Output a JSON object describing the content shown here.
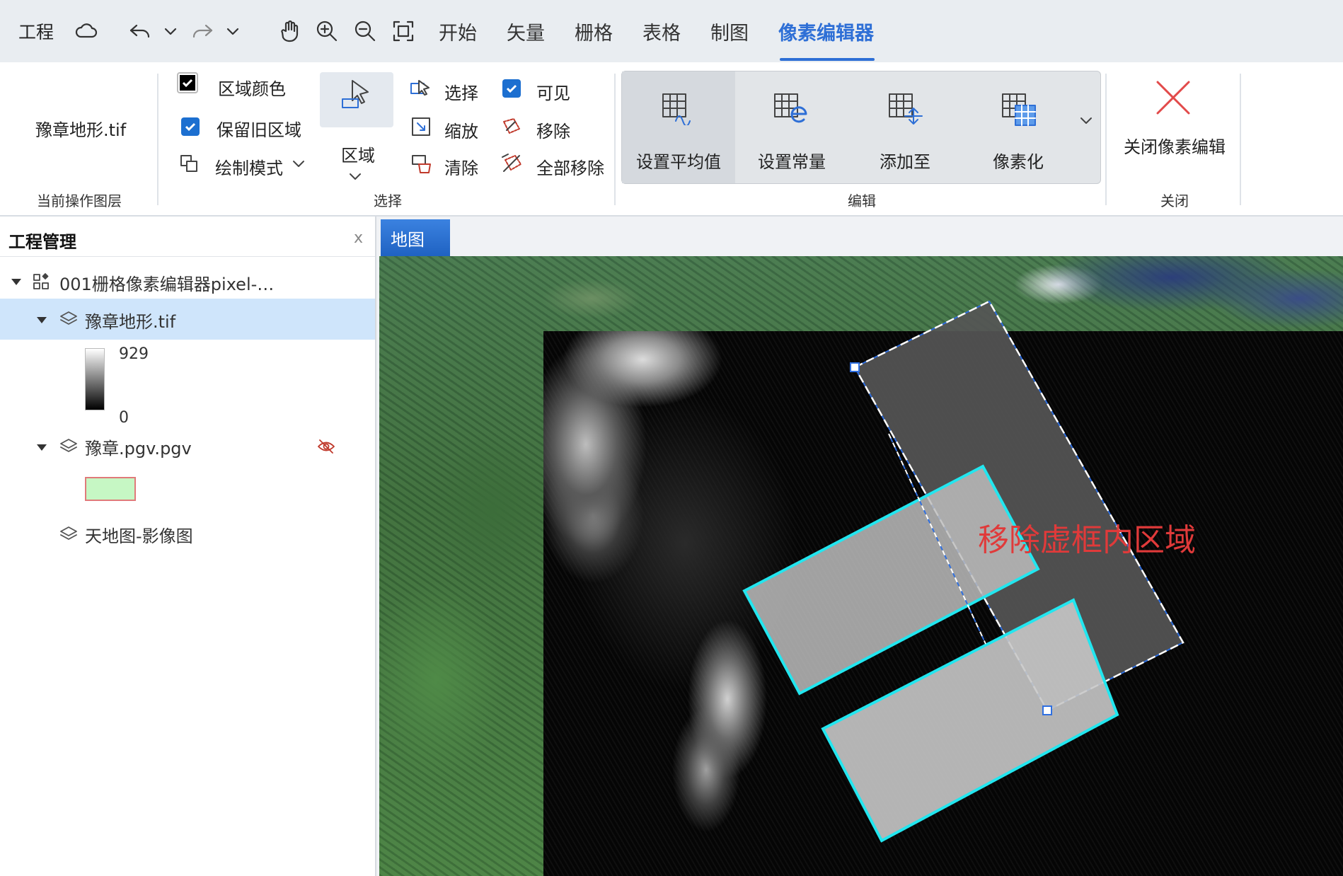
{
  "quick_access": {
    "project": "工程",
    "icons": [
      "cloud-icon",
      "undo-icon",
      "undo-dropdown-icon",
      "redo-icon",
      "redo-dropdown-icon",
      "pan-hand-icon",
      "zoom-in-icon",
      "zoom-out-icon",
      "full-extent-icon"
    ]
  },
  "menu_tabs": [
    "开始",
    "矢量",
    "栅格",
    "表格",
    "制图",
    "像素编辑器"
  ],
  "active_tab": "像素编辑器",
  "ribbon": {
    "layer_group": {
      "layer_name": "豫章地形.tif",
      "label": "当前操作图层"
    },
    "select_group": {
      "label": "选择",
      "region_color": "区域颜色",
      "keep_old_region": "保留旧区域",
      "draw_mode": "绘制模式",
      "region": "区域",
      "select": "选择",
      "zoom": "缩放",
      "clear": "清除",
      "visible": "可见",
      "remove": "移除",
      "remove_all": "全部移除",
      "checks": {
        "keep_old_region": true,
        "visible": true,
        "region_color": true
      }
    },
    "edit_group": {
      "label": "编辑",
      "set_average": "设置平均值",
      "set_constant": "设置常量",
      "add_to": "添加至",
      "pixelate": "像素化"
    },
    "close_group": {
      "label": "关闭",
      "close_pixel_edit": "关闭像素编辑"
    }
  },
  "project_panel": {
    "title": "工程管理",
    "close": "x",
    "tree": {
      "project": "001栅格像素编辑器pixel-…",
      "layers": [
        {
          "name": "豫章地形.tif",
          "selected": true,
          "legend_max": "929",
          "legend_min": "0"
        },
        {
          "name": "豫章.pgv.pgv",
          "hidden": true,
          "legend_fill": "#c6f7c4",
          "legend_stroke": "#e07a7a"
        },
        {
          "name": "天地图-影像图"
        }
      ]
    }
  },
  "map": {
    "tab": "地图",
    "annotation": "移除虚框内区域",
    "colors": {
      "selection_outline": "#22e6ef",
      "dash_frame": "#2f6fe0",
      "annotation": "#e03a3a"
    }
  },
  "colors": {
    "accent": "#2e6fd6",
    "selected_row": "#cfe5fb",
    "checkbox": "#1c6fd0"
  }
}
